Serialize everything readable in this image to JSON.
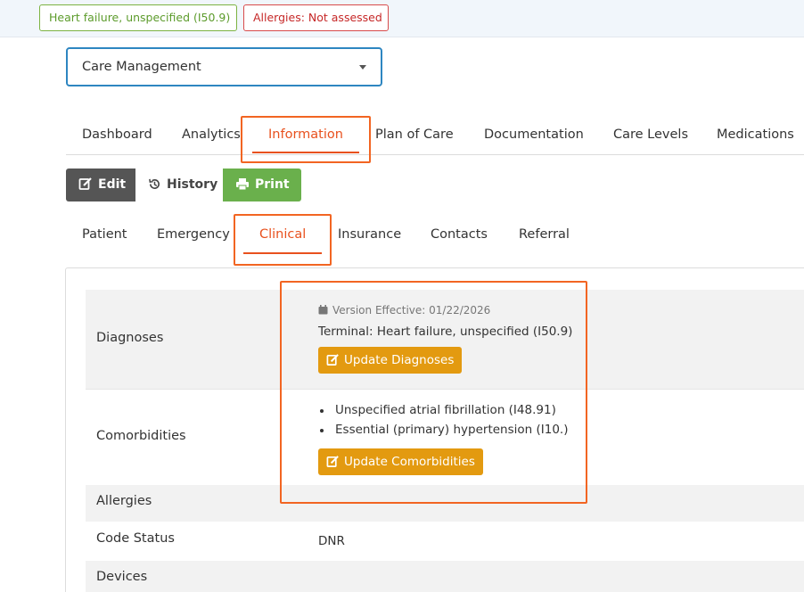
{
  "alerts": {
    "diagnosis_badge": "Heart failure, unspecified (I50.9)",
    "allergies_badge": "Allergies: Not assessed"
  },
  "program_select": {
    "value": "Care Management"
  },
  "main_tabs": [
    "Dashboard",
    "Analytics",
    "Information",
    "Plan of Care",
    "Documentation",
    "Care Levels",
    "Medications"
  ],
  "main_tab_active": "Information",
  "actions": {
    "edit": "Edit",
    "history": "History",
    "print": "Print"
  },
  "sub_tabs": [
    "Patient",
    "Emergency",
    "Clinical",
    "Insurance",
    "Contacts",
    "Referral"
  ],
  "sub_tab_active": "Clinical",
  "clinical": {
    "diagnoses": {
      "label": "Diagnoses",
      "version_effective": "Version Effective: 01/22/2026",
      "terminal_label": "Terminal:",
      "terminal_value": "Heart failure, unspecified (I50.9)",
      "update_button": "Update Diagnoses"
    },
    "comorbidities": {
      "label": "Comorbidities",
      "items": [
        "Unspecified atrial fibrillation (I48.91)",
        "Essential (primary) hypertension (I10.)"
      ],
      "update_button": "Update Comorbidities"
    },
    "allergies": {
      "label": "Allergies"
    },
    "code_status": {
      "label": "Code Status",
      "value": "DNR"
    },
    "devices": {
      "label": "Devices"
    }
  },
  "colors": {
    "accent": "#e8511e",
    "highlight_box": "#f26522",
    "update_button": "#e39a10",
    "print_button": "#6ab04c",
    "edit_button": "#555555",
    "select_border": "#2e86c1"
  }
}
